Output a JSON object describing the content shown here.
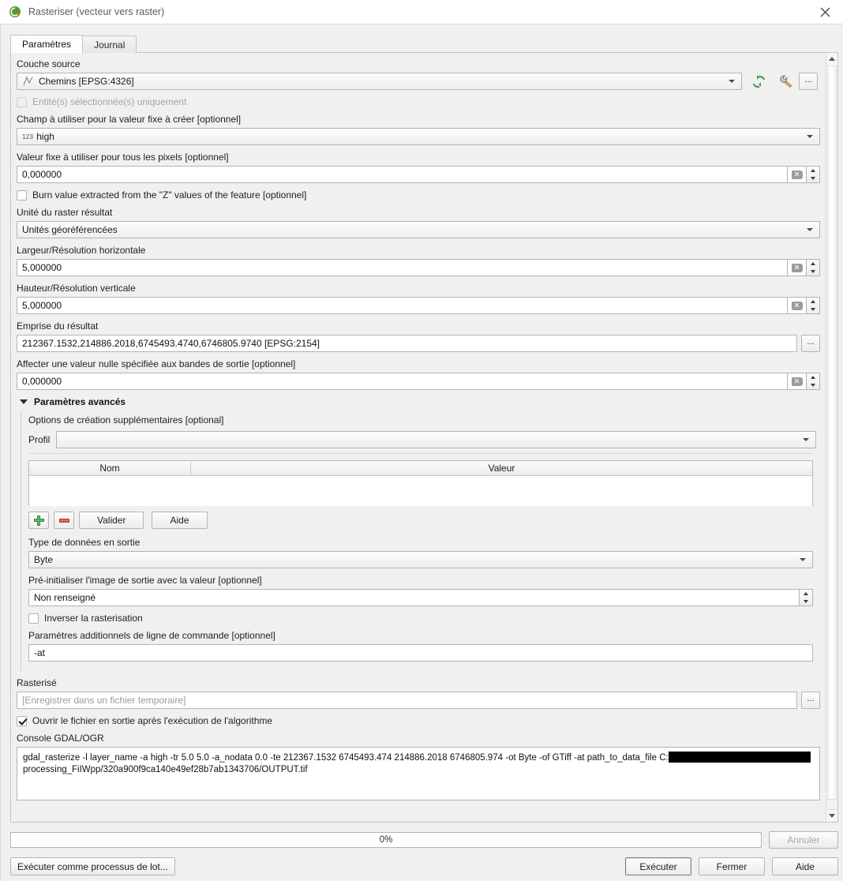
{
  "window": {
    "title": "Rasteriser (vecteur vers raster)",
    "logo_icon": "qgis-logo-icon",
    "close_icon": "close-icon"
  },
  "tabs": [
    {
      "label": "Paramètres",
      "active": true
    },
    {
      "label": "Journal",
      "active": false
    }
  ],
  "form": {
    "source_layer": {
      "label": "Couche source",
      "value": "Chemins [EPSG:4326]",
      "layer_icon": "line-layer-icon",
      "refresh_icon": "refresh-icon",
      "tool_icon": "wrench-icon",
      "browse_label": "..."
    },
    "selected_only": {
      "label": "Entité(s) sélectionnée(s) uniquement",
      "checked": false,
      "enabled": false
    },
    "burn_field": {
      "label": "Champ à utiliser pour la valeur fixe à créer [optionnel]",
      "value": "high",
      "type_icon": "number-field-icon",
      "type_icon_text": "123"
    },
    "burn_value": {
      "label": "Valeur fixe à utiliser pour tous les pixels [optionnel]",
      "value": "0,000000"
    },
    "use_z": {
      "label": "Burn value extracted from the \"Z\" values of the feature [optionnel]",
      "checked": false
    },
    "units": {
      "label": "Unité du raster résultat",
      "value": "Unités géoréférencées"
    },
    "width": {
      "label": "Largeur/Résolution horizontale",
      "value": "5,000000"
    },
    "height": {
      "label": "Hauteur/Résolution verticale",
      "value": "5,000000"
    },
    "extent": {
      "label": "Emprise du résultat",
      "value": "212367.1532,214886.2018,6745493.4740,6746805.9740 [EPSG:2154]",
      "browse_label": "..."
    },
    "nodata": {
      "label": "Affecter une valeur nulle spécifiée aux bandes de sortie [optionnel]",
      "value": "0,000000"
    }
  },
  "advanced": {
    "title": "Paramètres avancés",
    "expanded": true,
    "creation_options_label": "Options de création supplémentaires [optional]",
    "profil_label": "Profil",
    "profil_value": "",
    "table": {
      "columns": [
        "Nom",
        "Valeur"
      ],
      "rows": []
    },
    "buttons": {
      "add_icon": "plus-icon",
      "remove_icon": "minus-icon",
      "validate": "Valider",
      "help": "Aide"
    },
    "data_type": {
      "label": "Type de données en sortie",
      "value": "Byte"
    },
    "init_value": {
      "label": "Pré-initialiser l'image de sortie avec la valeur [optionnel]",
      "value": "Non renseigné"
    },
    "invert": {
      "label": "Inverser la rasterisation",
      "checked": false
    },
    "extra_params": {
      "label": "Paramètres additionnels de ligne de commande [optionnel]",
      "value": "-at"
    }
  },
  "output": {
    "label": "Rasterisé",
    "placeholder": "[Enregistrer dans un fichier temporaire]",
    "value": "",
    "browse_label": "...",
    "open_after": {
      "label": "Ouvrir le fichier en sortie après l'exécution de l'algorithme",
      "checked": true
    }
  },
  "console": {
    "label": "Console GDAL/OGR",
    "line1_a": "gdal_rasterize -l layer_name -a high -tr 5.0 5.0 -a_nodata 0.0 -te 212367.1532 6745493.474 214886.2018 6746805.974 -ot Byte -of GTiff -at path_to_data_file C:",
    "redacted": true,
    "line2": "processing_FiIWpp/320a900f9ca140e49ef28b7ab1343706/OUTPUT.tif"
  },
  "footer": {
    "progress_text": "0%",
    "progress_percent": 0,
    "cancel": "Annuler",
    "cancel_enabled": false,
    "batch": "Exécuter comme processus de lot...",
    "run": "Exécuter",
    "close": "Fermer",
    "help": "Aide"
  }
}
